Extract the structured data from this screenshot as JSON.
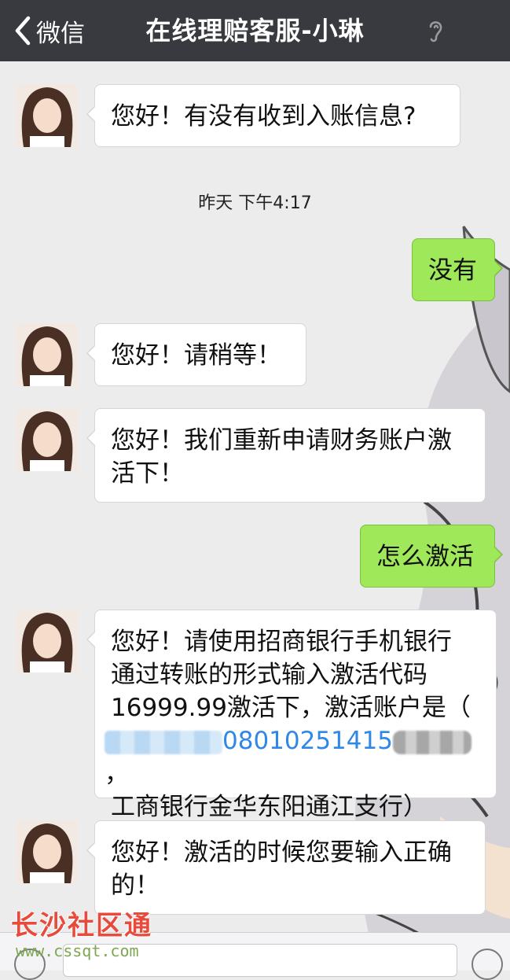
{
  "header": {
    "back_label": "微信",
    "title": "在线理赔客服-小琳"
  },
  "messages": [
    {
      "side": "left",
      "text": "您好！有没有收到入账信息?"
    },
    {
      "side": "right",
      "text": "没有"
    },
    {
      "side": "left",
      "text": "您好！请稍等！"
    },
    {
      "side": "left",
      "text": "您好！我们重新申请财务账户激活下！"
    },
    {
      "side": "right",
      "text": "怎么激活"
    },
    {
      "side": "left",
      "lines": [
        "您好！请使用招商银行手机银行",
        "通过转账的形式输入激活代码",
        "16999.99激活下，激活账户是（",
        "工商银行金华东阳通江支行）"
      ],
      "account_visible": "08010251415",
      "account_suffix": "，"
    },
    {
      "side": "left",
      "text": "您好！激活的时候您要输入正确的！"
    }
  ],
  "timestamp": "昨天 下午4:17",
  "watermark": {
    "title": "长沙社区通",
    "url": "www.cssqt.com"
  },
  "icons": [
    "chevron-left-icon",
    "ear-icon",
    "voice-icon",
    "emoji-icon"
  ],
  "colors": {
    "nav_bg": "#393a3f",
    "sent_bubble": "#9fe85a",
    "received_bubble": "#ffffff",
    "link_blue": "#2f88e6",
    "watermark_red": "#e84a3c"
  }
}
